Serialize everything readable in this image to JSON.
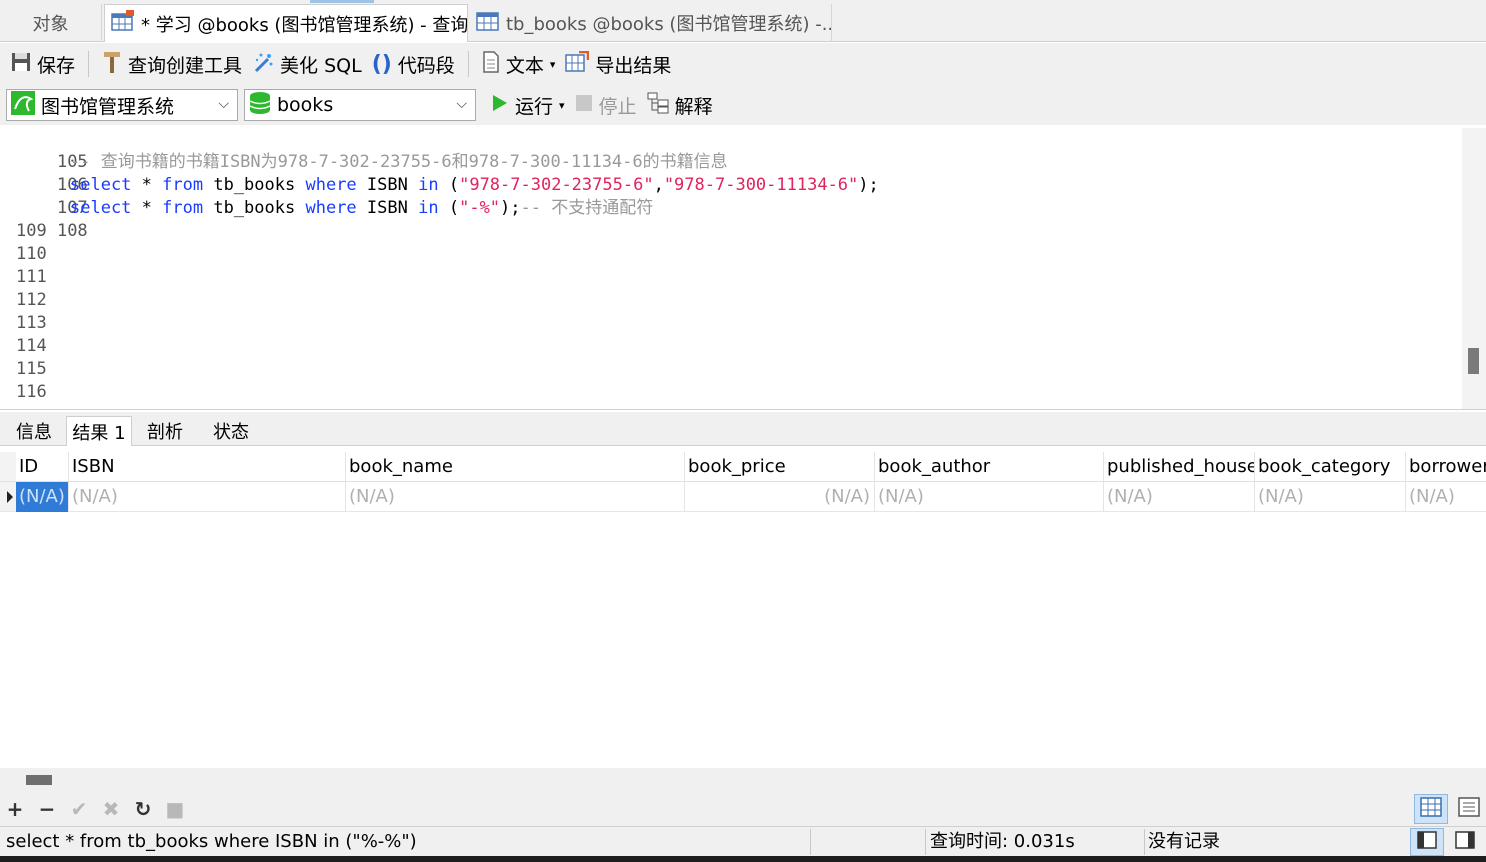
{
  "tabs": {
    "objects": "对象",
    "query": "* 学习 @books (图书馆管理系统) - 查询",
    "table": "tb_books @books (图书馆管理系统) -..."
  },
  "toolbar": {
    "save": "保存",
    "query_builder": "查询创建工具",
    "beautify": "美化 SQL",
    "snippet": "代码段",
    "text": "文本",
    "export": "导出结果"
  },
  "connection": {
    "server": "图书馆管理系统",
    "database": "books",
    "run": "运行",
    "stop": "停止",
    "explain": "解释"
  },
  "editor": {
    "lines": [
      {
        "n": "105",
        "text": ""
      },
      {
        "n": "106",
        "text": "-- 查询书籍的书籍ISBN为978-7-302-23755-6和978-7-300-11134-6的书籍信息"
      },
      {
        "n": "107",
        "text": "select * from tb_books where ISBN in (\"978-7-302-23755-6\",\"978-7-300-11134-6\");"
      },
      {
        "n": "108",
        "text": "select * from tb_books where ISBN in (\"-%\");-- 不支持通配符"
      },
      {
        "n": "109",
        "text": ""
      },
      {
        "n": "110",
        "text": ""
      },
      {
        "n": "111",
        "text": ""
      },
      {
        "n": "112",
        "text": ""
      },
      {
        "n": "113",
        "text": ""
      },
      {
        "n": "114",
        "text": ""
      },
      {
        "n": "115",
        "text": ""
      },
      {
        "n": "116",
        "text": ""
      }
    ]
  },
  "result_tabs": [
    "信息",
    "结果 1",
    "剖析",
    "状态"
  ],
  "grid": {
    "columns": [
      "ID",
      "ISBN",
      "book_name",
      "book_price",
      "book_author",
      "published_house",
      "book_category",
      "borrower"
    ],
    "row": [
      "(N/A)",
      "(N/A)",
      "(N/A)",
      "(N/A)",
      "(N/A)",
      "(N/A)",
      "(N/A)",
      "(N/A)"
    ]
  },
  "status": {
    "sql": "select * from tb_books where ISBN in (\"%-%\")",
    "query_time": "查询时间: 0.031s",
    "records": "没有记录"
  },
  "colors": {
    "keyword": "#1a3cff",
    "string": "#e0245e",
    "comment": "#999999",
    "selection": "#2f7bd6",
    "run_green": "#2eb82e"
  }
}
